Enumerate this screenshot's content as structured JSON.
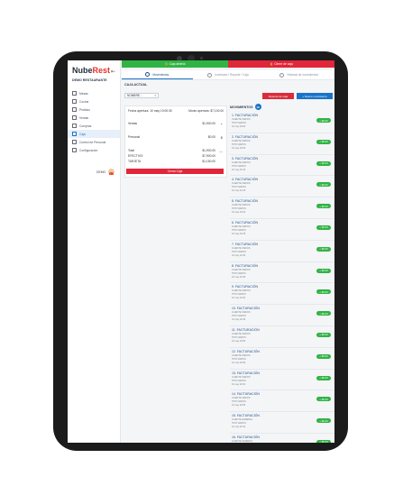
{
  "app": {
    "logo_main": "Nube",
    "logo_accent": "Rest",
    "restaurant": "DEMO RESTAURANTE"
  },
  "sidebar": {
    "items": [
      {
        "label": "Mesas",
        "active": false
      },
      {
        "label": "Cocina",
        "active": false
      },
      {
        "label": "Pedidos",
        "active": false
      },
      {
        "label": "Ventas",
        "active": false
      },
      {
        "label": "Compras",
        "active": false
      },
      {
        "label": "Caja",
        "active": true
      },
      {
        "label": "Control de Personal",
        "active": false
      },
      {
        "label": "Configuración",
        "active": false
      }
    ],
    "user": "DEMO"
  },
  "topbar": {
    "open_label": "Caja abierta",
    "close_label": "Cierre de caja"
  },
  "tabs": [
    {
      "label": "Movimientos",
      "active": true
    },
    {
      "label": "Inventario / Reporte / Caja",
      "active": false
    },
    {
      "label": "Historial de movimientos",
      "active": false
    }
  ],
  "section_title": "CAJA ACTUAL",
  "cash": {
    "select_value": "NOMBRE...",
    "opened": "Fecha apertura: 10 may 19:00:30",
    "closed": "Monto apertura: $7,100.00",
    "rows": [
      {
        "label": "Ventas",
        "value": "$1,900.00",
        "op": "+"
      },
      {
        "label": "Personal",
        "value": "$0.00",
        "op": "$"
      },
      {
        "label": "Total",
        "value": "$1,900.00",
        "op": "—"
      },
      {
        "label": "EFECTIVO",
        "value": "$7,900.00",
        "op": ""
      },
      {
        "label": "TARJETA",
        "value": "$1,150.00",
        "op": ""
      }
    ],
    "close_button": "Cerrar Caja"
  },
  "actions": {
    "report": "Reporte de caja",
    "new_move": "+ Nuevo movimiento"
  },
  "movements": {
    "title": "MOVIMIENTOS",
    "count": "16",
    "items": [
      {
        "title": "1. FACTURACIÓN",
        "client": "CLIENTE VARIOS",
        "type": "TIPO VARIOS",
        "date": "10 may 19:00",
        "amount": "+ $0.00"
      },
      {
        "title": "2. FACTURACIÓN",
        "client": "CLIENTE VARIOS",
        "type": "TIPO VARIOS",
        "date": "10 may 19:05",
        "amount": "+ $0.00"
      },
      {
        "title": "3. FACTURACIÓN",
        "client": "CLIENTE VARIOS",
        "type": "TIPO VARIOS",
        "date": "10 may 19:10",
        "amount": "+ $0.00"
      },
      {
        "title": "4. FACTURACIÓN",
        "client": "CLIENTE VARIOS",
        "type": "TIPO VARIOS",
        "date": "10 may 19:15",
        "amount": "+ $0.00"
      },
      {
        "title": "5. FACTURACIÓN",
        "client": "CLIENTE VARIOS",
        "type": "TIPO VARIOS",
        "date": "10 may 19:20",
        "amount": "+ $0.00"
      },
      {
        "title": "6. FACTURACIÓN",
        "client": "CLIENTE VARIOS",
        "type": "TIPO VARIOS",
        "date": "10 may 19:25",
        "amount": "+ $0.00"
      },
      {
        "title": "7. FACTURACIÓN",
        "client": "CLIENTE VARIOS",
        "type": "TIPO VARIOS",
        "date": "10 may 19:30",
        "amount": "+ $0.00"
      },
      {
        "title": "8. FACTURACIÓN",
        "client": "CLIENTE VARIOS",
        "type": "TIPO VARIOS",
        "date": "10 may 19:35",
        "amount": "+ $0.00"
      },
      {
        "title": "9. FACTURACIÓN",
        "client": "CLIENTE VARIOS",
        "type": "TIPO VARIOS",
        "date": "10 may 19:40",
        "amount": "+ $0.00"
      },
      {
        "title": "10. FACTURACIÓN",
        "client": "CLIENTE VARIOS",
        "type": "TIPO VARIOS",
        "date": "10 may 19:45",
        "amount": "+ $0.00"
      },
      {
        "title": "11. FACTURACIÓN",
        "client": "CLIENTE VARIOS",
        "type": "TIPO VARIOS",
        "date": "10 may 19:50",
        "amount": "+ $0.00"
      },
      {
        "title": "12. FACTURACIÓN",
        "client": "CLIENTE VARIOS",
        "type": "TIPO VARIOS",
        "date": "10 may 19:55",
        "amount": "+ $0.00"
      },
      {
        "title": "13. FACTURACIÓN",
        "client": "CLIENTE VARIOS",
        "type": "TIPO VARIOS",
        "date": "10 may 20:00",
        "amount": "+ $0.00"
      },
      {
        "title": "14. FACTURACIÓN",
        "client": "CLIENTE VARIOS",
        "type": "TIPO VARIOS",
        "date": "10 may 20:05",
        "amount": "+ $0.00"
      },
      {
        "title": "15. FACTURACIÓN",
        "client": "CLIENTE GENERAL",
        "type": "TIPO VARIOS",
        "date": "10 may 20:10",
        "amount": "+ $0.00"
      },
      {
        "title": "16. FACTURACIÓN",
        "client": "CLIENTE GENERAL",
        "type": "TIPO VARIOS",
        "date": "10 may 20:15",
        "amount": "+ $0.00"
      }
    ]
  }
}
